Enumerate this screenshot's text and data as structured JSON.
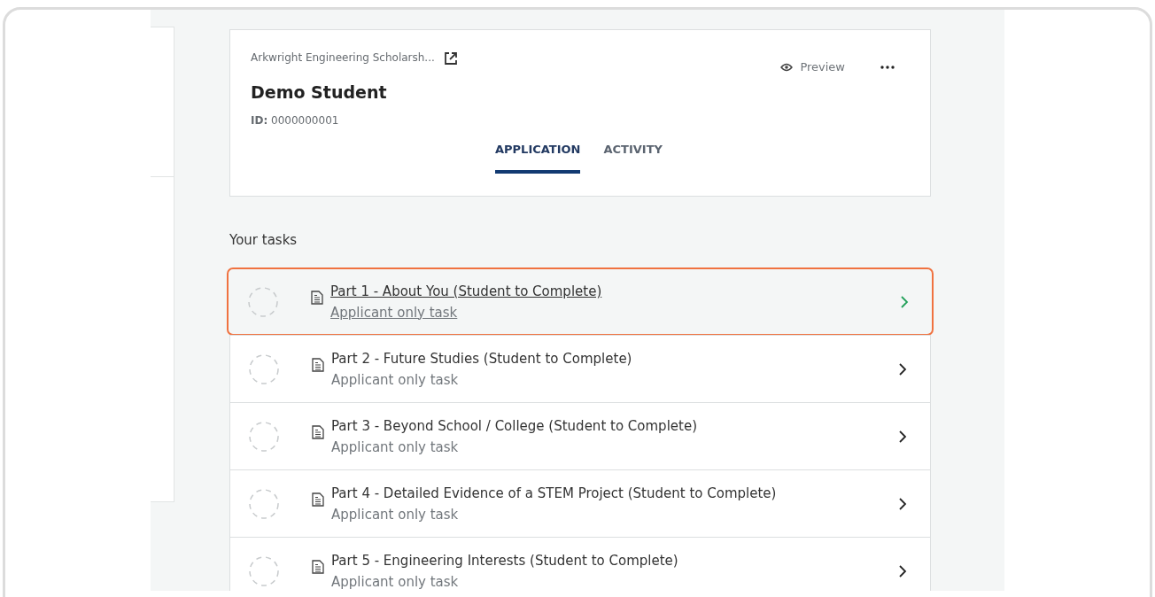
{
  "header": {
    "program": "Arkwright Engineering Scholarsh...",
    "applicant": "Demo Student",
    "id_label": "ID:",
    "id_value": "0000000001",
    "preview": "Preview"
  },
  "tabs": [
    {
      "label": "APPLICATION",
      "selected": true
    },
    {
      "label": "ACTIVITY",
      "selected": false
    }
  ],
  "tasks_heading": "Your tasks",
  "tasks": [
    {
      "title": "Part 1 - About You (Student to Complete)",
      "subtitle": "Applicant only task",
      "selected": true
    },
    {
      "title": "Part 2 - Future Studies (Student to Complete)",
      "subtitle": "Applicant only task",
      "selected": false
    },
    {
      "title": "Part 3 - Beyond School / College (Student to Complete)",
      "subtitle": "Applicant only task",
      "selected": false
    },
    {
      "title": "Part 4 - Detailed Evidence of a STEM Project (Student to Complete)",
      "subtitle": "Applicant only task",
      "selected": false
    },
    {
      "title": "Part 5 - Engineering Interests (Student to Complete)",
      "subtitle": "Applicant only task",
      "selected": false
    }
  ]
}
